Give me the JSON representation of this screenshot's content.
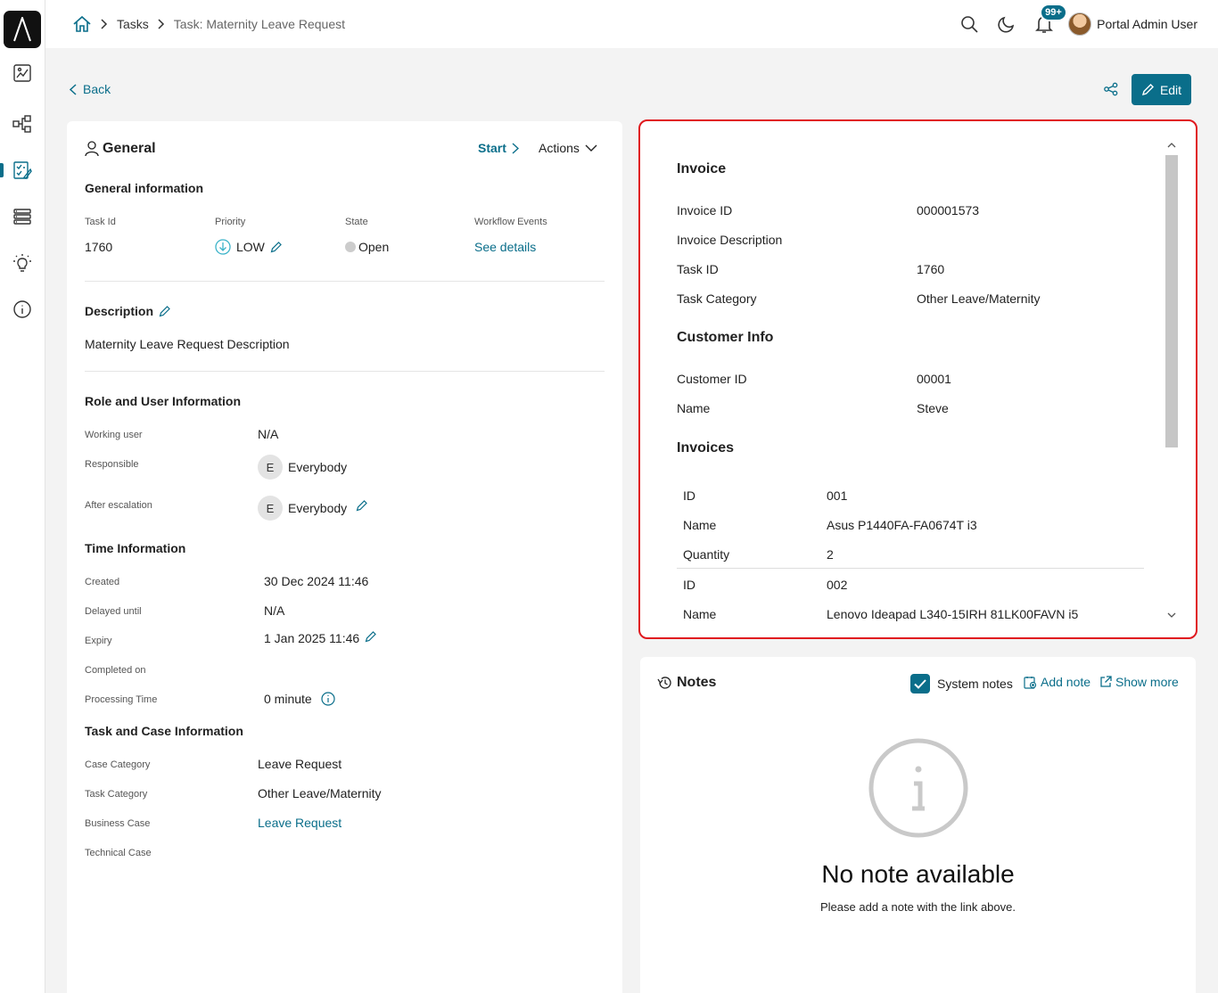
{
  "breadcrumb": {
    "tasks": "Tasks",
    "current": "Task: Maternity Leave Request"
  },
  "header": {
    "notification_count": "99+",
    "user_name": "Portal Admin User"
  },
  "toolbar": {
    "back_label": "Back",
    "edit_label": "Edit"
  },
  "general": {
    "title": "General",
    "start_label": "Start",
    "actions_label": "Actions",
    "general_info_heading": "General information",
    "task_id_label": "Task Id",
    "task_id": "1760",
    "priority_label": "Priority",
    "priority": "LOW",
    "state_label": "State",
    "state": "Open",
    "workflow_label": "Workflow Events",
    "workflow_link": "See details",
    "description_heading": "Description",
    "description": "Maternity Leave Request Description",
    "role_heading": "Role and User Information",
    "working_user_label": "Working user",
    "working_user": "N/A",
    "responsible_label": "Responsible",
    "responsible_initial": "E",
    "responsible": "Everybody",
    "after_escalation_label": "After escalation",
    "after_escalation_initial": "E",
    "after_escalation": "Everybody",
    "time_heading": "Time Information",
    "created_label": "Created",
    "created": "30 Dec 2024 11:46",
    "delayed_label": "Delayed until",
    "delayed": "N/A",
    "expiry_label": "Expiry",
    "expiry": "1 Jan 2025 11:46",
    "completed_label": "Completed on",
    "processing_label": "Processing Time",
    "processing": "0 minute",
    "case_heading": "Task and Case Information",
    "case_category_label": "Case Category",
    "case_category": "Leave Request",
    "task_category_label": "Task Category",
    "task_category": "Other Leave/Maternity",
    "business_case_label": "Business Case",
    "business_case": "Leave Request",
    "technical_case_label": "Technical Case"
  },
  "invoice": {
    "heading": "Invoice",
    "invoice_id_label": "Invoice ID",
    "invoice_id": "000001573",
    "invoice_desc_label": "Invoice Description",
    "task_id_label": "Task ID",
    "task_id": "1760",
    "task_category_label": "Task Category",
    "task_category": "Other Leave/Maternity",
    "customer_heading": "Customer Info",
    "customer_id_label": "Customer ID",
    "customer_id": "00001",
    "name_label": "Name",
    "name": "Steve",
    "invoices_heading": "Invoices",
    "items": [
      {
        "id_label": "ID",
        "id": "001",
        "name_label": "Name",
        "name": "Asus P1440FA-FA0674T i3",
        "qty_label": "Quantity",
        "qty": "2"
      },
      {
        "id_label": "ID",
        "id": "002",
        "name_label": "Name",
        "name": "Lenovo Ideapad L340-15IRH 81LK00FAVN i5"
      }
    ]
  },
  "notes": {
    "title": "Notes",
    "system_notes_label": "System notes",
    "add_note_label": "Add note",
    "show_more_label": "Show more",
    "empty_title": "No note available",
    "empty_subtitle": "Please add a note with the link above."
  },
  "colors": {
    "accent": "#0a6e8a",
    "highlight_border": "#e0191f"
  }
}
